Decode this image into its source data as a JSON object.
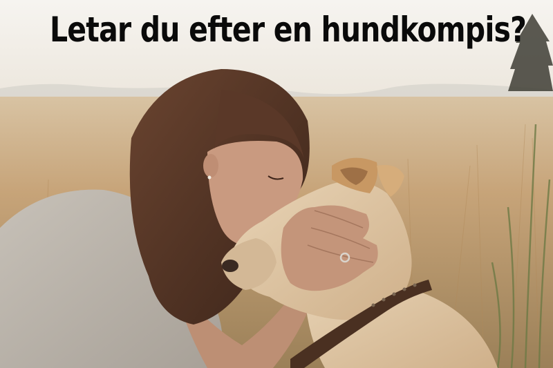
{
  "headline": {
    "text": "Letar du efter en hundkompis?",
    "color": "#0a0a0a"
  },
  "photo": {
    "palette": {
      "sky": "#f4f1ec",
      "field": "#c9a57a",
      "hair": "#4e3222",
      "skin": "#c99a80",
      "shirt": "#b9b2a8",
      "dog_fur": "#dcc3a1",
      "collar": "#4a3021"
    }
  }
}
